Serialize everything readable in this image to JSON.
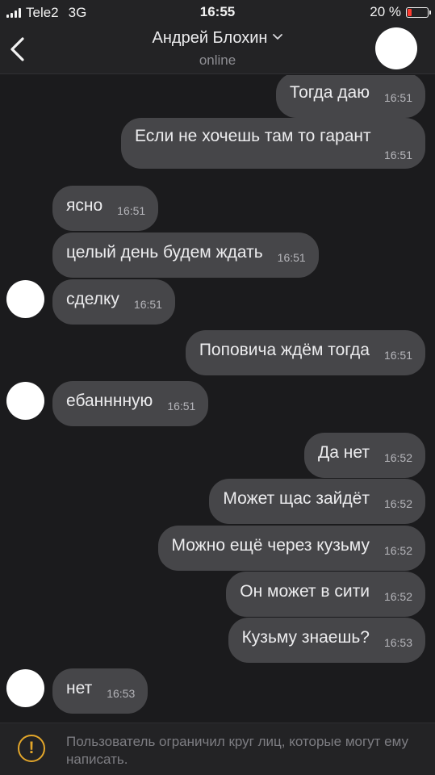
{
  "status_bar": {
    "carrier": "Tele2",
    "network": "3G",
    "time": "16:55",
    "battery": "20 %",
    "battery_level": 0.2,
    "battery_color": "#ff3b30"
  },
  "header": {
    "name": "Андрей Блохин",
    "status": "online"
  },
  "messages": [
    {
      "dir": "out",
      "text": "Тогда даю",
      "time": "16:51"
    },
    {
      "dir": "out",
      "text": "Если не хочешь там то гарант",
      "time": "16:51"
    },
    {
      "dir": "in",
      "text": "ясно",
      "time": "16:51"
    },
    {
      "dir": "in",
      "text": "целый день будем ждать",
      "time": "16:51"
    },
    {
      "dir": "in",
      "text": "сделку",
      "time": "16:51"
    },
    {
      "dir": "out",
      "text": "Поповича ждём тогда",
      "time": "16:51"
    },
    {
      "dir": "in",
      "text": "ебанннную",
      "time": "16:51"
    },
    {
      "dir": "out",
      "text": "Да нет",
      "time": "16:52"
    },
    {
      "dir": "out",
      "text": "Может щас зайдёт",
      "time": "16:52"
    },
    {
      "dir": "out",
      "text": "Можно ещё через кузьму",
      "time": "16:52"
    },
    {
      "dir": "out",
      "text": "Он может в сити",
      "time": "16:52"
    },
    {
      "dir": "out",
      "text": "Кузьму знаешь?",
      "time": "16:53"
    },
    {
      "dir": "in",
      "text": "нет",
      "time": "16:53"
    }
  ],
  "footer": {
    "notice": "Пользователь ограничил круг лиц, которые могут ему написать.",
    "icon": "warning-icon",
    "icon_color": "#e3a62a"
  },
  "colors": {
    "background": "#1b1b1d",
    "bubble": "#464649",
    "bar": "#232325"
  }
}
